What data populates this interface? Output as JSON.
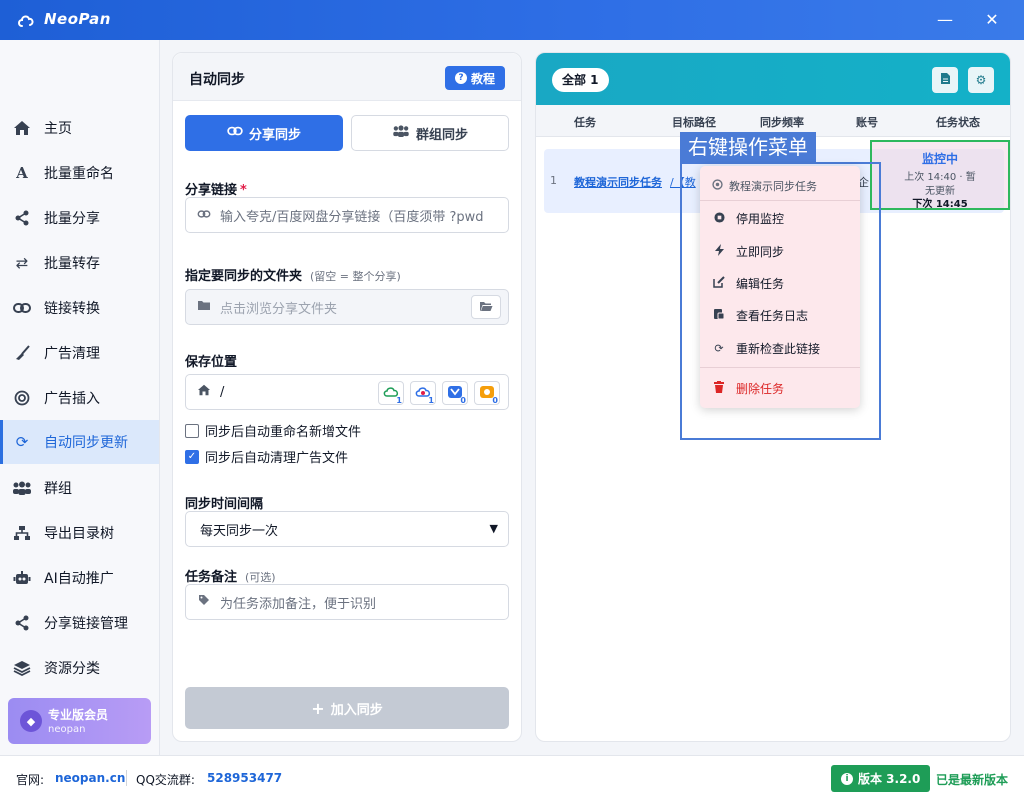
{
  "app": {
    "title": "NeoPan",
    "minimize_icon": "minus-icon",
    "close_icon": "close-icon"
  },
  "sidebar": {
    "items": [
      {
        "label": "主页",
        "icon": "home-icon"
      },
      {
        "label": "批量重命名",
        "icon": "rename-icon"
      },
      {
        "label": "批量分享",
        "icon": "share-icon"
      },
      {
        "label": "批量转存",
        "icon": "transfer-icon"
      },
      {
        "label": "链接转换",
        "icon": "link-icon"
      },
      {
        "label": "广告清理",
        "icon": "broom-icon"
      },
      {
        "label": "广告插入",
        "icon": "target-icon"
      },
      {
        "label": "自动同步更新",
        "icon": "sync-icon",
        "active": true
      },
      {
        "label": "群组",
        "icon": "group-icon"
      },
      {
        "label": "导出目录树",
        "icon": "tree-icon"
      },
      {
        "label": "AI自动推广",
        "icon": "robot-icon"
      },
      {
        "label": "分享链接管理",
        "icon": "share-icon"
      },
      {
        "label": "资源分类",
        "icon": "layers-icon"
      }
    ],
    "pro": {
      "title": "专业版会员",
      "subtitle": "neopan"
    }
  },
  "form": {
    "title": "自动同步",
    "tutorial_label": "教程",
    "tabs": [
      {
        "label": "分享同步",
        "active": true
      },
      {
        "label": "群组同步",
        "active": false
      }
    ],
    "share_link": {
      "label": "分享链接",
      "required": "*",
      "placeholder": "输入夸克/百度网盘分享链接（百度须带 ?pwd"
    },
    "folder": {
      "label": "指定要同步的文件夹",
      "hint": "(留空 = 整个分享)",
      "placeholder": "点击浏览分享文件夹"
    },
    "save_location": {
      "label": "保存位置",
      "path": "/",
      "drive_counts": [
        "1",
        "1",
        "0",
        "0"
      ]
    },
    "checkboxes": [
      {
        "label": "同步后自动重命名新增文件",
        "checked": false
      },
      {
        "label": "同步后自动清理广告文件",
        "checked": true
      }
    ],
    "interval": {
      "label": "同步时间间隔",
      "value": "每天同步一次"
    },
    "note": {
      "label": "任务备注",
      "hint": "(可选)",
      "placeholder": "为任务添加备注，便于识别"
    },
    "submit_label": "加入同步"
  },
  "tasks": {
    "filter_label": "全部 1",
    "columns": [
      "任务",
      "目标路径",
      "同步频率",
      "账号",
      "任务状态"
    ],
    "rows": [
      {
        "index": "1",
        "name": "教程演示同步任务",
        "path": "/【教",
        "account": "企",
        "status": "监控中",
        "last": "上次 14:40 · 暂",
        "last_result": "无更新",
        "next": "下次 14:45"
      }
    ]
  },
  "annotation": {
    "label": "右键操作菜单"
  },
  "context_menu": {
    "title": "教程演示同步任务",
    "items": [
      {
        "label": "停用监控",
        "icon": "stop-icon"
      },
      {
        "label": "立即同步",
        "icon": "bolt-icon"
      },
      {
        "label": "编辑任务",
        "icon": "edit-icon"
      },
      {
        "label": "查看任务日志",
        "icon": "log-icon"
      },
      {
        "label": "重新检查此链接",
        "icon": "refresh-icon"
      }
    ],
    "danger": {
      "label": "删除任务",
      "icon": "trash-icon"
    }
  },
  "footer": {
    "site_label": "官网:",
    "site": "neopan.cn",
    "qq_label": "QQ交流群:",
    "qq": "528953477",
    "version": "版本 3.2.0",
    "latest": "已是最新版本"
  },
  "colors": {
    "primary": "#2f6fe6",
    "teal": "#19a8c4",
    "green": "#1e9d57",
    "danger": "#dc2626"
  }
}
